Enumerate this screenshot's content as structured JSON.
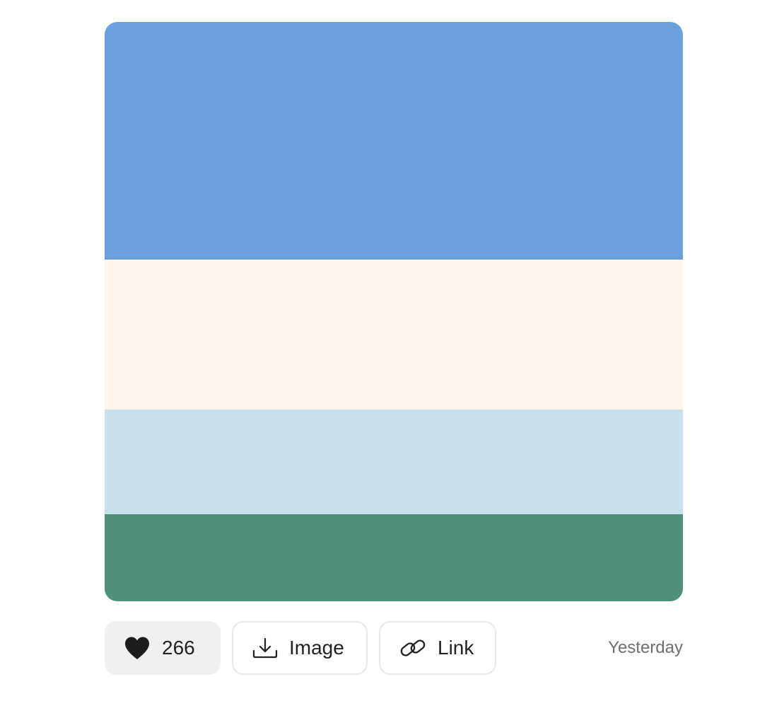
{
  "palette": {
    "colors": [
      {
        "hex": "#6ca0dc"
      },
      {
        "hex": "#fdf5eb"
      },
      {
        "hex": "#c8e0eb"
      },
      {
        "hex": "#4f9078"
      }
    ]
  },
  "actions": {
    "likes": "266",
    "image_label": "Image",
    "link_label": "Link",
    "timestamp": "Yesterday"
  },
  "icons": {
    "like": "heart-icon",
    "image": "download-icon",
    "link": "link-icon"
  }
}
